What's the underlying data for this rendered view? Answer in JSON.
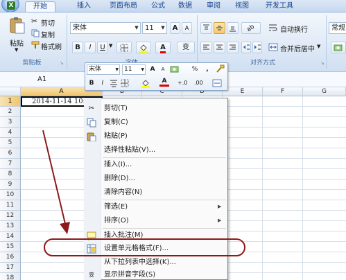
{
  "ribbon": {
    "tabs": [
      {
        "label": "开始"
      },
      {
        "label": "插入"
      },
      {
        "label": "页面布局"
      },
      {
        "label": "公式"
      },
      {
        "label": "数据"
      },
      {
        "label": "审阅"
      },
      {
        "label": "视图"
      },
      {
        "label": "开发工具"
      }
    ],
    "office_button_glyph": "X",
    "clipboard": {
      "paste_label": "粘贴",
      "cut_label": "剪切",
      "copy_label": "复制",
      "format_painter_label": "格式刷",
      "group_label": "剪贴板"
    },
    "font": {
      "font_name": "宋体",
      "font_size": "11",
      "grow_label": "A",
      "shrink_label": "A",
      "bold_label": "B",
      "italic_label": "I",
      "underline_label": "U",
      "font_color_label": "A",
      "phonetic_label": "变",
      "group_label": "字体"
    },
    "alignment": {
      "wrap_text_label": "自动换行",
      "merge_center_label": "合并后居中",
      "group_label": "对齐方式"
    },
    "number": {
      "format_value": "常规"
    }
  },
  "formula_bar": {
    "name_box": "A1"
  },
  "sheet": {
    "columns": [
      "A",
      "B",
      "C",
      "D",
      "E",
      "F",
      "G"
    ],
    "rows": [
      "1",
      "2",
      "3",
      "4",
      "5",
      "6",
      "7",
      "8",
      "9",
      "10",
      "11",
      "12",
      "13",
      "14",
      "15",
      "16",
      "17",
      "18"
    ],
    "a1_value": "2014-11-14 10:05"
  },
  "mini_toolbar": {
    "font_name": "宋体",
    "font_size": "11",
    "grow_label": "A",
    "shrink_label": "A",
    "percent_label": "%",
    "comma_label": ",",
    "bold_label": "B",
    "italic_label": "I",
    "font_color_label": "A",
    "inc_decimal_label": "+.0",
    "dec_decimal_label": ".00"
  },
  "context_menu": {
    "items": [
      {
        "label": "剪切(T)"
      },
      {
        "label": "复制(C)"
      },
      {
        "label": "粘贴(P)"
      },
      {
        "label": "选择性粘贴(V)..."
      },
      {
        "label": "插入(I)..."
      },
      {
        "label": "删除(D)..."
      },
      {
        "label": "清除内容(N)"
      },
      {
        "label": "筛选(E)"
      },
      {
        "label": "排序(O)"
      },
      {
        "label": "插入批注(M)"
      },
      {
        "label": "设置单元格格式(F)..."
      },
      {
        "label": "从下拉列表中选择(K)..."
      },
      {
        "label": "显示拼音字段(S)"
      }
    ]
  },
  "colors": {
    "annotation": "#8b1a1a",
    "selected_header": "#f1c56b",
    "tab_text": "#15428b"
  }
}
